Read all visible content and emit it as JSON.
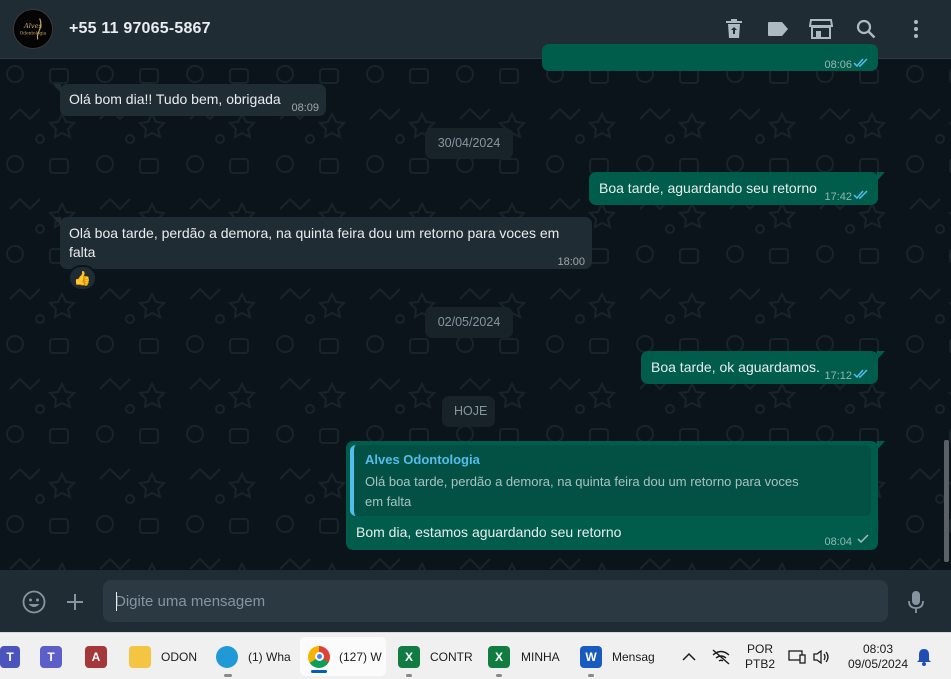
{
  "header": {
    "avatar_logo": "Alves Odontologia",
    "contact_name": "+55 11 97065-5867",
    "icons": [
      "delete-icon",
      "label-icon",
      "catalog-icon",
      "search-icon",
      "menu-icon"
    ]
  },
  "messages": {
    "partial_out_time": "08:06",
    "m1_text": "Olá bom dia!! Tudo bem, obrigada",
    "m1_time": "08:09",
    "date1": "30/04/2024",
    "m2_text": "Boa tarde, aguardando seu retorno",
    "m2_time": "17:42",
    "m3_text_line1": "Olá boa tarde, perdão a demora, na quinta feira dou um retorno para voces em",
    "m3_text_line2": "falta",
    "m3_time": "18:00",
    "m3_reaction": "👍",
    "date2": "02/05/2024",
    "m4_text": "Boa tarde, ok aguardamos.",
    "m4_time": "17:12",
    "date3": "HOJE",
    "quote_author": "Alves Odontologia",
    "quote_line1": "Olá boa tarde, perdão a demora, na quinta feira dou um retorno para voces",
    "quote_line2": "em falta",
    "m5_text": "Bom dia, estamos aguardando seu retorno",
    "m5_time": "08:04"
  },
  "composer": {
    "placeholder": "Digite uma mensagem",
    "icons": [
      "emoji-icon",
      "attach-plus-icon",
      "microphone-icon"
    ]
  },
  "taskbar": {
    "items": [
      {
        "label": ""
      },
      {
        "label": ""
      },
      {
        "label": ""
      },
      {
        "label": "ODON"
      },
      {
        "label": "(1) Wha"
      },
      {
        "label": "(127) W"
      },
      {
        "label": "CONTR"
      },
      {
        "label": "MINHA"
      },
      {
        "label": "Mensag"
      }
    ],
    "language_line1": "POR",
    "language_line2": "PTB2",
    "clock_time": "08:03",
    "clock_date": "09/05/2024"
  },
  "colors": {
    "chat_bg": "#0b141a",
    "header_bg": "#202c33",
    "incoming_bubble": "#202c33",
    "outgoing_bubble": "#005c4b",
    "read_ticks": "#53bdeb",
    "quote_accent": "#53bdeb"
  }
}
